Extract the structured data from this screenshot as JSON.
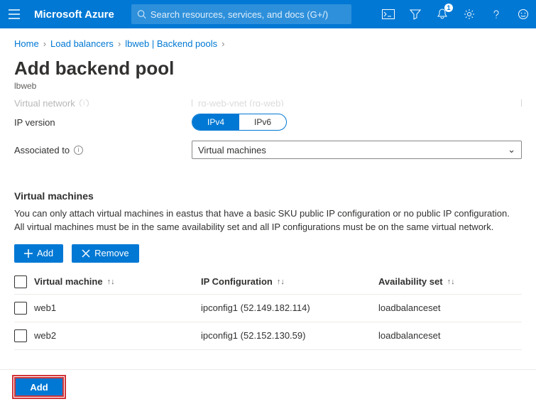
{
  "brand": "Microsoft Azure",
  "search": {
    "placeholder": "Search resources, services, and docs (G+/)"
  },
  "notifications": {
    "count": "1"
  },
  "breadcrumb": {
    "items": [
      "Home",
      "Load balancers",
      "lbweb | Backend pools"
    ]
  },
  "title": "Add backend pool",
  "subtitle": "lbweb",
  "form": {
    "vnet_label": "Virtual network",
    "vnet_value": "rg-web-vnet (rg-web)",
    "ipversion_label": "IP version",
    "ipv4": "IPv4",
    "ipv6": "IPv6",
    "assoc_label": "Associated to",
    "assoc_value": "Virtual machines"
  },
  "vm_section": {
    "header": "Virtual machines",
    "desc": "You can only attach virtual machines in eastus that have a basic SKU public IP configuration or no public IP configuration. All virtual machines must be in the same availability set and all IP configurations must be on the same virtual network.",
    "add_btn": "Add",
    "remove_btn": "Remove",
    "cols": {
      "vm": "Virtual machine",
      "ip": "IP Configuration",
      "as": "Availability set"
    },
    "rows": [
      {
        "vm": "web1",
        "ip": "ipconfig1 (52.149.182.114)",
        "as": "loadbalanceset"
      },
      {
        "vm": "web2",
        "ip": "ipconfig1 (52.152.130.59)",
        "as": "loadbalanceset"
      }
    ]
  },
  "footer": {
    "add": "Add"
  }
}
